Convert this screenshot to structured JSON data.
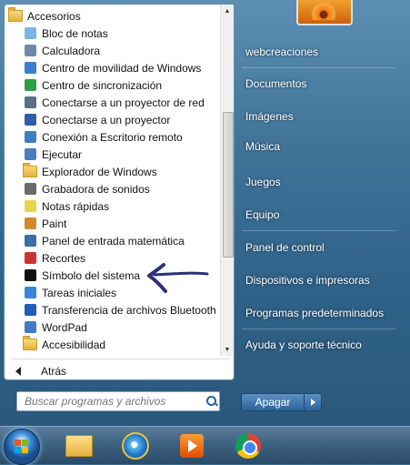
{
  "programs": {
    "folder_label": "Accesorios",
    "items": [
      {
        "label": "Bloc de notas",
        "icon": "notepad-icon",
        "color": "#7db4e6"
      },
      {
        "label": "Calculadora",
        "icon": "calculator-icon",
        "color": "#6c8aa8"
      },
      {
        "label": "Centro de movilidad de Windows",
        "icon": "mobility-center-icon",
        "color": "#3a7fd0"
      },
      {
        "label": "Centro de sincronización",
        "icon": "sync-center-icon",
        "color": "#2ea043"
      },
      {
        "label": "Conectarse a un proyector de red",
        "icon": "network-projector-icon",
        "color": "#5a6f86"
      },
      {
        "label": "Conectarse a un proyector",
        "icon": "projector-icon",
        "color": "#2d5fa8"
      },
      {
        "label": "Conexión a Escritorio remoto",
        "icon": "remote-desktop-icon",
        "color": "#3d7fc1"
      },
      {
        "label": "Ejecutar",
        "icon": "run-icon",
        "color": "#4a7cc0"
      },
      {
        "label": "Explorador de Windows",
        "icon": "folder-icon",
        "color": "#e2b23d"
      },
      {
        "label": "Grabadora de sonidos",
        "icon": "microphone-icon",
        "color": "#6a6a6a"
      },
      {
        "label": "Notas rápidas",
        "icon": "sticky-notes-icon",
        "color": "#e7d44a"
      },
      {
        "label": "Paint",
        "icon": "paint-icon",
        "color": "#d48a2a"
      },
      {
        "label": "Panel de entrada matemática",
        "icon": "math-input-icon",
        "color": "#3c6ea8"
      },
      {
        "label": "Recortes",
        "icon": "scissors-icon",
        "color": "#c33"
      },
      {
        "label": "Símbolo del sistema",
        "icon": "command-prompt-icon",
        "color": "#111111"
      },
      {
        "label": "Tareas iniciales",
        "icon": "getting-started-icon",
        "color": "#3a86d8"
      },
      {
        "label": "Transferencia de archivos Bluetooth",
        "icon": "bluetooth-icon",
        "color": "#1f5fb8"
      },
      {
        "label": "WordPad",
        "icon": "wordpad-icon",
        "color": "#3f7bc7"
      },
      {
        "label": "Accesibilidad",
        "icon": "folder-icon",
        "color": "#e2b23d"
      }
    ],
    "back_label": "Atrás"
  },
  "search": {
    "placeholder": "Buscar programas y archivos"
  },
  "right": {
    "links": [
      "webcreaciones",
      "Documentos",
      "Imágenes",
      "Música",
      "Juegos",
      "Equipo",
      "Panel de control",
      "Dispositivos e impresoras",
      "Programas predeterminados",
      "Ayuda y soporte técnico"
    ],
    "shutdown_label": "Apagar"
  },
  "taskbar": {
    "icons": [
      "windows-explorer-icon",
      "internet-explorer-icon",
      "media-player-icon",
      "chrome-icon"
    ]
  }
}
